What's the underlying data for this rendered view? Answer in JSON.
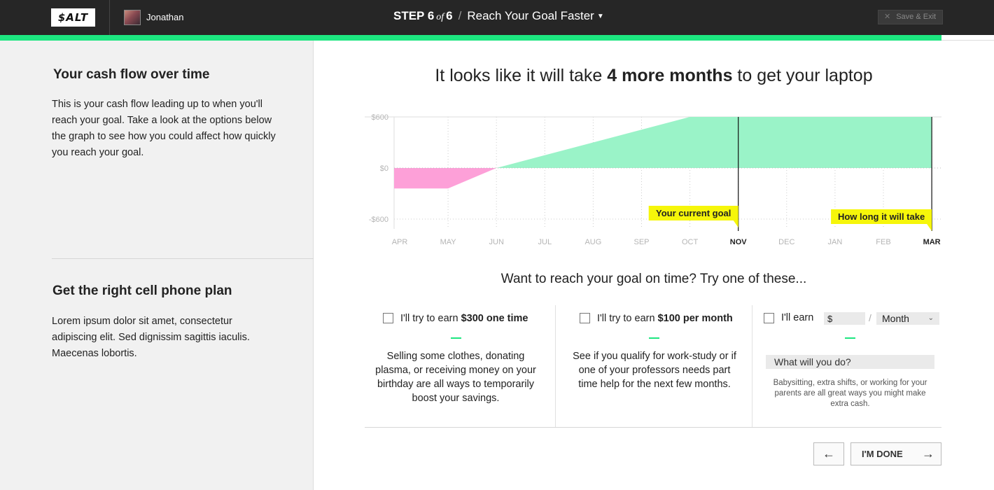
{
  "header": {
    "logo": "$ALT",
    "user_name": "Jonathan",
    "step_word": "STEP 6",
    "step_of": "of",
    "step_total": "6",
    "goal_title": "Reach Your Goal Faster",
    "save_exit": "Save & Exit",
    "progress": 0.947
  },
  "sidebar": {
    "section1_title": "Your cash flow over time",
    "section1_text": "This is your cash flow leading up to when you'll reach your goal. Take a look at the options below the graph to see how you could affect how quickly you reach your goal.",
    "section2_title": "Get the right cell phone plan",
    "section2_text": "Lorem ipsum dolor sit amet, consectetur adipiscing elit. Sed dignissim sagittis iaculis. Maecenas lobortis."
  },
  "main": {
    "headline_pre": "It looks like it will take ",
    "headline_bold": "4 more months",
    "headline_post": " to get your laptop",
    "try_heading": "Want to reach your goal on time? Try one of these...",
    "option1": {
      "label_pre": "I'll try to earn ",
      "label_bold": "$300 one time",
      "desc": "Selling some clothes, donating plasma, or receiving money on your birthday are all ways to temporarily boost your savings."
    },
    "option2": {
      "label_pre": "I'll try to earn ",
      "label_bold": "$100 per month",
      "desc": "See if you qualify for work-study or if one of your professors needs part time help for the next few months."
    },
    "option3": {
      "label": "I'll earn",
      "amount_value": "$",
      "period_value": "Month",
      "what_placeholder": "What will you do?",
      "desc": "Babysitting, extra shifts, or working for your parents are all great ways you might make extra cash."
    },
    "back_button": "←",
    "done_button": "I'M DONE",
    "done_arrow": "→"
  },
  "chart_data": {
    "type": "area",
    "x": [
      "APR",
      "MAY",
      "JUN",
      "JUL",
      "AUG",
      "SEP",
      "OCT",
      "NOV",
      "DEC",
      "JAN",
      "FEB",
      "MAR"
    ],
    "y_ticks": [
      "$600",
      "$0",
      "-$600"
    ],
    "ylim": [
      -600,
      600
    ],
    "points": [
      {
        "x": "APR",
        "y": -240
      },
      {
        "x": "MAY",
        "y": -240
      },
      {
        "x": "JUN",
        "y": 0
      },
      {
        "x": "OCT",
        "y": 600
      },
      {
        "x": "MAR",
        "y": 600
      }
    ],
    "negative_color": "#fda0d8",
    "positive_color": "#9af3c8",
    "highlight_color": "#f6f60a",
    "markers": [
      {
        "x": "NOV",
        "label": "Your current goal"
      },
      {
        "x": "MAR",
        "label": "How long it will take"
      }
    ],
    "bold_ticks": [
      "NOV",
      "MAR"
    ],
    "grid": true
  }
}
